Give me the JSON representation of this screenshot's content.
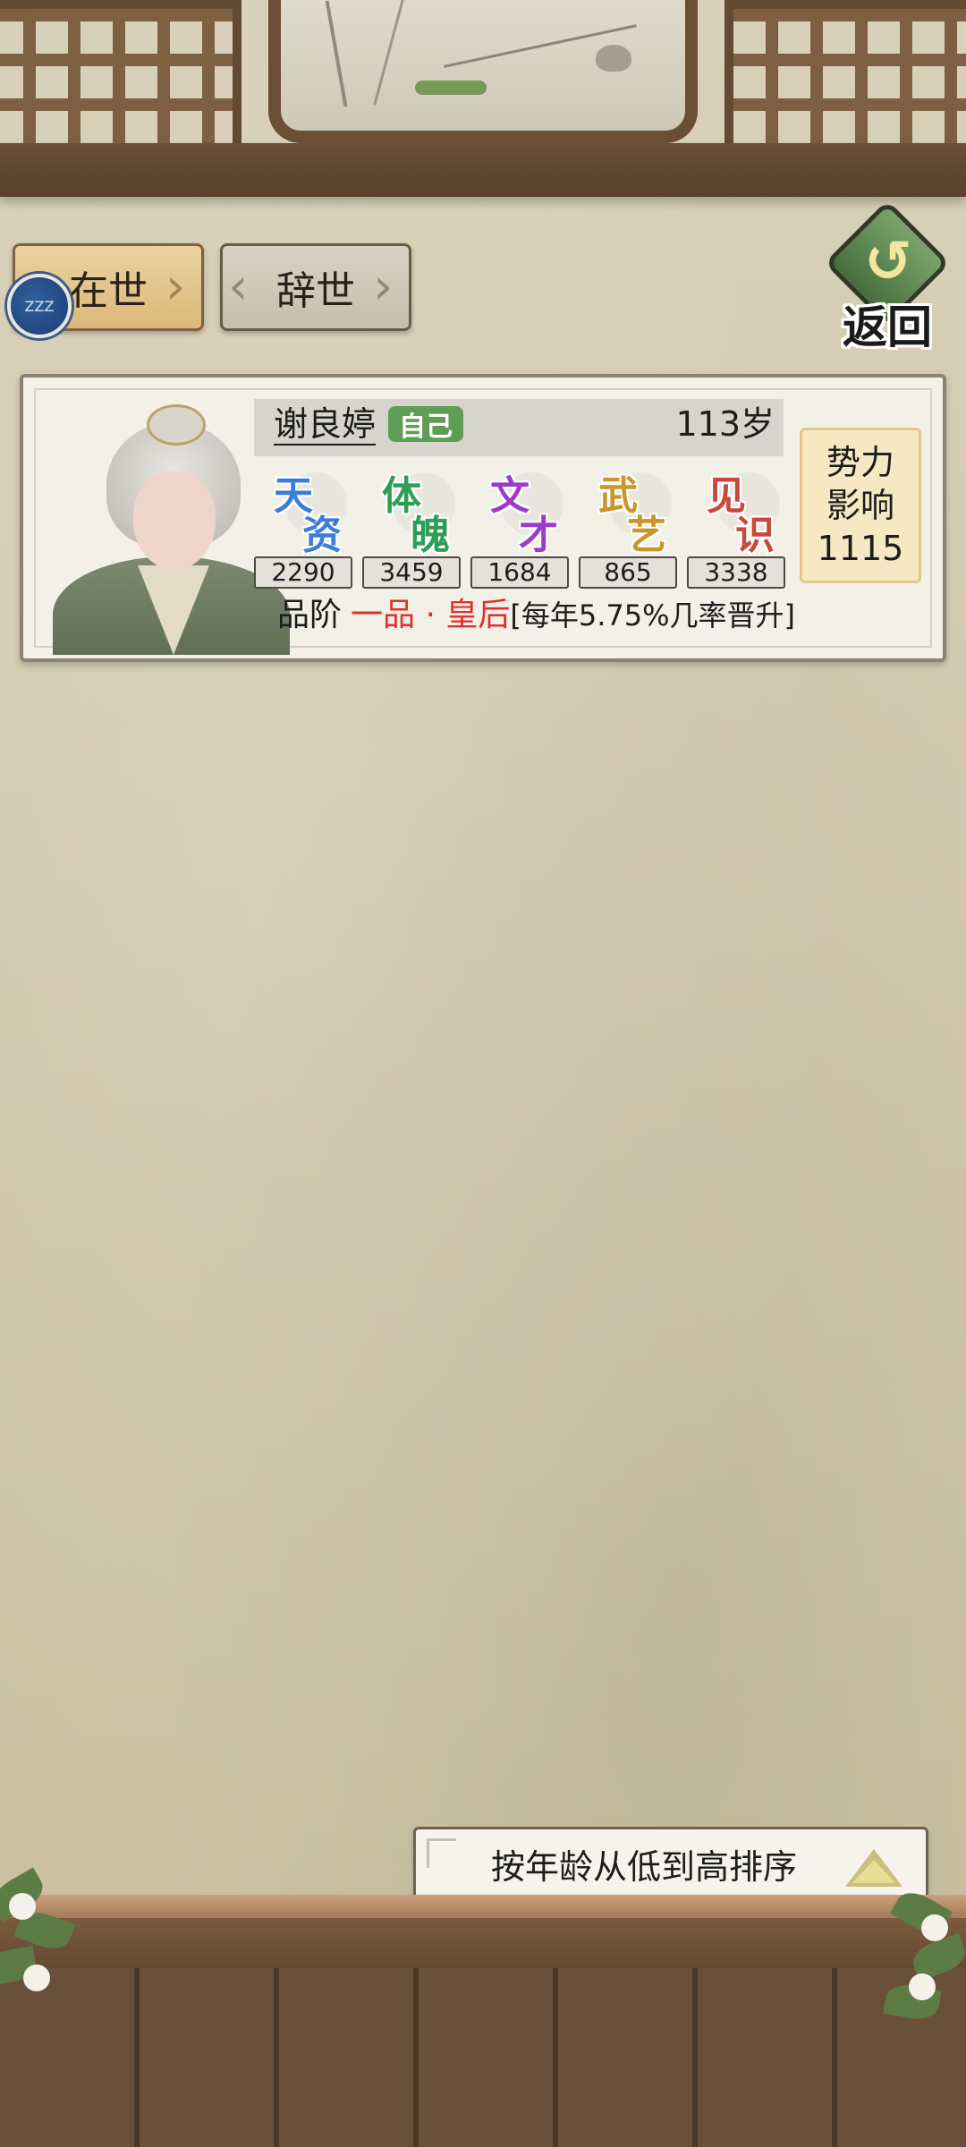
{
  "tabs": [
    {
      "label": "在世",
      "active": true
    },
    {
      "label": "辞世",
      "active": false
    }
  ],
  "bubble_text": "ZZZ",
  "back_button": {
    "label": "返回",
    "icon": "return-arrow-icon"
  },
  "character": {
    "name": "谢良婷",
    "badge": "自己",
    "age": "113岁",
    "attributes": [
      {
        "chars": [
          "天",
          "资"
        ],
        "value": "2290",
        "color": "#3b7dd8"
      },
      {
        "chars": [
          "体",
          "魄"
        ],
        "value": "3459",
        "color": "#2e9e55"
      },
      {
        "chars": [
          "文",
          "才"
        ],
        "value": "1684",
        "color": "#9b3bc9"
      },
      {
        "chars": [
          "武",
          "艺"
        ],
        "value": "865",
        "color": "#c9962b"
      },
      {
        "chars": [
          "见",
          "识"
        ],
        "value": "3338",
        "color": "#c9473b"
      }
    ],
    "rank_label": "品阶",
    "rank_value": "一品 · 皇后",
    "rank_note": "[每年5.75%几率晋升]",
    "influence": {
      "line1": "势力",
      "line2": "影响",
      "value": "1115"
    }
  },
  "sort_button": {
    "label": "按年龄从低到高排序",
    "icon": "triangle-up-icon"
  }
}
